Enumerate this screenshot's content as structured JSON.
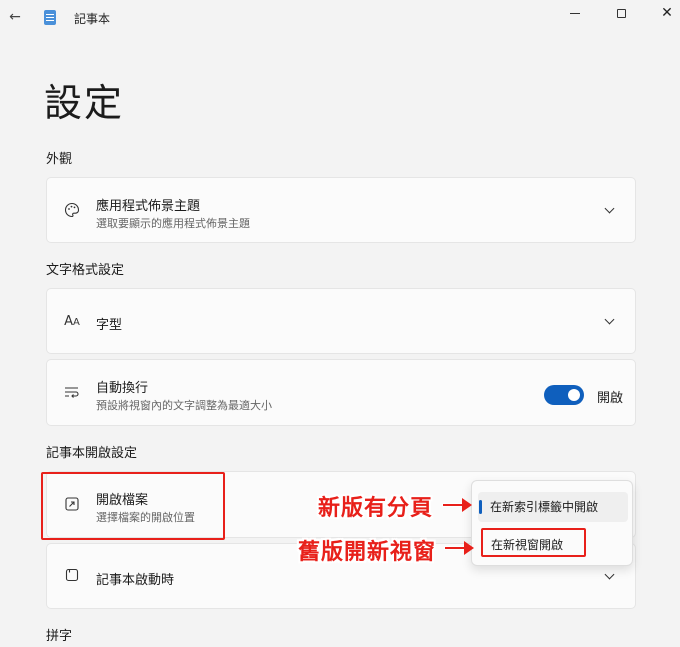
{
  "window": {
    "app_title": "記事本",
    "back_icon": "back-arrow-icon",
    "min_icon": "minimize-icon",
    "max_icon": "maximize-icon",
    "close_icon": "close-icon"
  },
  "page": {
    "title": "設定"
  },
  "sections": {
    "appearance": "外觀",
    "text_format": "文字格式設定",
    "open_settings": "記事本開啟設定",
    "spelling": "拼字"
  },
  "cards": {
    "theme": {
      "title": "應用程式佈景主題",
      "desc": "選取要顯示的應用程式佈景主題",
      "icon": "palette-icon"
    },
    "font": {
      "title": "字型",
      "icon": "font-size-icon"
    },
    "wordwrap": {
      "title": "自動換行",
      "desc": "預設將視窗內的文字調整為最適大小",
      "icon": "word-wrap-icon",
      "toggle_label": "開啟",
      "toggle_on": true
    },
    "open_file": {
      "title": "開啟檔案",
      "desc": "選擇檔案的開啟位置",
      "icon": "open-file-icon"
    },
    "startup": {
      "title": "記事本啟動時",
      "icon": "notepad-icon"
    }
  },
  "dropdown": {
    "options": [
      "在新索引標籤中開啟",
      "在新視窗開啟"
    ],
    "selected_index": 0
  },
  "annotations": {
    "new_version": "新版有分頁",
    "old_version": "舊版開新視窗"
  },
  "colors": {
    "accent": "#0f5fbd",
    "annotation": "#e8201a"
  }
}
